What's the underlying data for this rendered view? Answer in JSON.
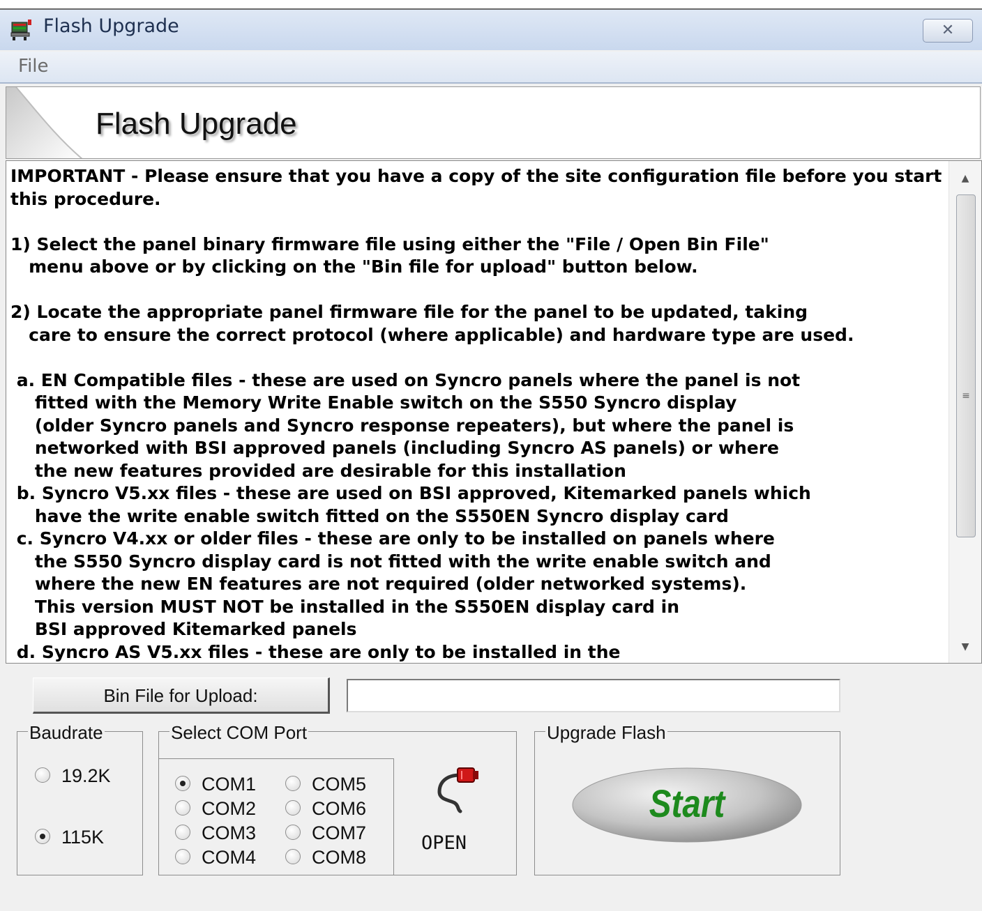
{
  "window": {
    "title": "Flash Upgrade",
    "close_glyph": "✕"
  },
  "menu": {
    "file_label": "File"
  },
  "banner": {
    "title": "Flash Upgrade"
  },
  "instructions": {
    "text": "IMPORTANT - Please ensure that you have a copy of the site configuration file before you start this procedure.\n\n1) Select the panel binary firmware file using either the \"File / Open Bin File\"\n   menu above or by clicking on the \"Bin file for upload\" button below.\n\n2) Locate the appropriate panel firmware file for the panel to be updated, taking\n   care to ensure the correct protocol (where applicable) and hardware type are used.\n\n a. EN Compatible files - these are used on Syncro panels where the panel is not\n    fitted with the Memory Write Enable switch on the S550 Syncro display\n    (older Syncro panels and Syncro response repeaters), but where the panel is\n    networked with BSI approved panels (including Syncro AS panels) or where\n    the new features provided are desirable for this installation\n b. Syncro V5.xx files - these are used on BSI approved, Kitemarked panels which\n    have the write enable switch fitted on the S550EN Syncro display card\n c. Syncro V4.xx or older files - these are only to be installed on panels where\n    the S550 Syncro display card is not fitted with the write enable switch and\n    where the new EN features are not required (older networked systems).\n    This version MUST NOT be installed in the S550EN display card in\n    BSI approved Kitemarked panels\n d. Syncro AS V5.xx files - these are only to be installed in the"
  },
  "upload": {
    "button_label": "Bin File for Upload:",
    "field_value": ""
  },
  "baudrate": {
    "label": "Baudrate",
    "options": [
      {
        "label": "19.2K",
        "checked": false
      },
      {
        "label": "115K",
        "checked": true
      }
    ]
  },
  "com_port": {
    "label": "Select COM Port",
    "options": [
      {
        "label": "COM1",
        "checked": true
      },
      {
        "label": "COM2",
        "checked": false
      },
      {
        "label": "COM3",
        "checked": false
      },
      {
        "label": "COM4",
        "checked": false
      },
      {
        "label": "COM5",
        "checked": false
      },
      {
        "label": "COM6",
        "checked": false
      },
      {
        "label": "COM7",
        "checked": false
      },
      {
        "label": "COM8",
        "checked": false
      }
    ],
    "open_label": "OPEN",
    "open_icon": "plug-icon"
  },
  "upgrade": {
    "label": "Upgrade Flash",
    "start_label": "Start"
  },
  "colors": {
    "start_text": "#1d8a1d",
    "plug_red": "#d01818"
  }
}
